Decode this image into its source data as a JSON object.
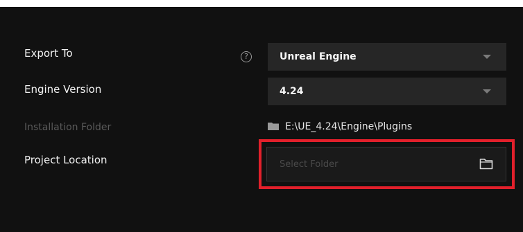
{
  "form": {
    "export_to": {
      "label": "Export To",
      "help_icon": "question-circle-icon",
      "value": "Unreal Engine"
    },
    "engine_version": {
      "label": "Engine Version",
      "value": "4.24"
    },
    "installation_folder": {
      "label": "Installation Folder",
      "path": "E:\\UE_4.24\\Engine\\Plugins",
      "icon": "folder-icon"
    },
    "project_location": {
      "label": "Project Location",
      "placeholder": "Select Folder",
      "value": "",
      "browse_icon": "folder-outline-icon"
    }
  },
  "colors": {
    "background": "#111111",
    "dropdown_bg": "#262626",
    "highlight": "#e2202b",
    "label_text": "#f2f2f2",
    "dim_text": "#5a5a5a"
  }
}
